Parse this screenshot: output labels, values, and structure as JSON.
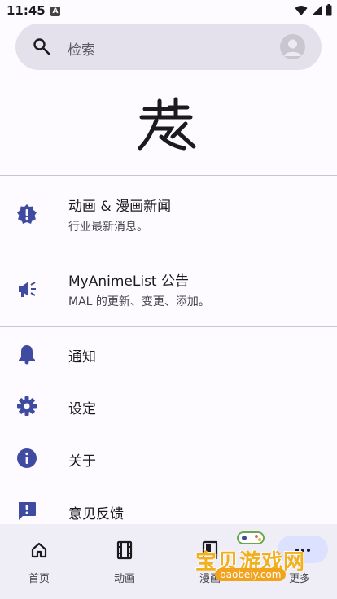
{
  "status_bar": {
    "time": "11:45",
    "sim_badge": "A"
  },
  "search": {
    "placeholder": "检索"
  },
  "news_items": [
    {
      "title": "动画 & 漫画新闻",
      "subtitle": "行业最新消息。",
      "icon": "alert-badge-icon"
    },
    {
      "title": "MyAnimeList 公告",
      "subtitle": "MAL 的更新、变更、添加。",
      "icon": "megaphone-icon"
    }
  ],
  "menu_items": [
    {
      "label": "通知",
      "icon": "bell-icon"
    },
    {
      "label": "设定",
      "icon": "gear-icon"
    },
    {
      "label": "关于",
      "icon": "info-icon"
    },
    {
      "label": "意见反馈",
      "icon": "feedback-icon"
    }
  ],
  "bottom_nav": [
    {
      "label": "首页",
      "icon": "home-icon"
    },
    {
      "label": "动画",
      "icon": "film-icon"
    },
    {
      "label": "漫画",
      "icon": "book-icon"
    },
    {
      "label": "更多",
      "icon": "more-icon",
      "active": true
    }
  ],
  "watermark": {
    "text": "宝贝游戏网",
    "url": "baobeiy.com"
  },
  "colors": {
    "accent": "#3f4ba0",
    "background": "#fdfbff",
    "nav_bg": "#efedf6",
    "active_pill": "#dbe1ff"
  }
}
